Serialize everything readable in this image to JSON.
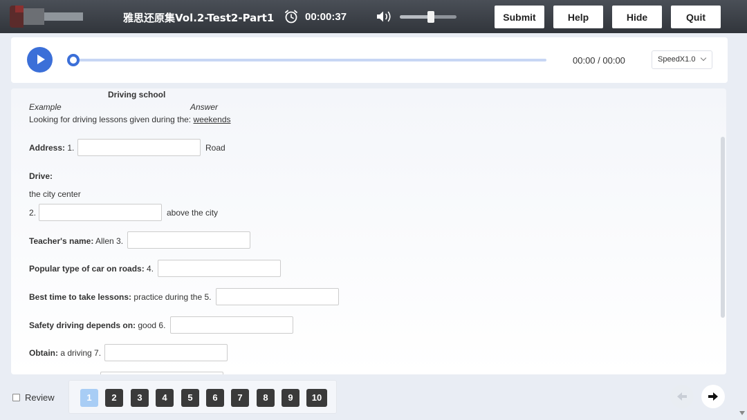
{
  "header": {
    "title": "雅思还原集Vol.2-Test2-Part1",
    "timer": "00:00:37",
    "volume_level": 0.55,
    "buttons": {
      "submit": "Submit",
      "help": "Help",
      "hide": "Hide",
      "quit": "Quit"
    }
  },
  "audio": {
    "time": "00:00 / 00:00",
    "progress": 0,
    "speed": "SpeedX1.0"
  },
  "form": {
    "heading": "Driving school",
    "example_label": "Example",
    "answer_label": "Answer",
    "example_text": "Looking for driving lessons given during the:",
    "example_answer": "weekends",
    "q1": {
      "label": "Address:",
      "number": "1.",
      "suffix": "Road",
      "value": ""
    },
    "drive_label": "Drive:",
    "drive_line": "the city center",
    "q2": {
      "number": "2.",
      "suffix": "above the city",
      "value": ""
    },
    "q3": {
      "label": "Teacher's name:",
      "prefix": "Allen 3.",
      "value": ""
    },
    "q4": {
      "label": "Popular type of car on roads:",
      "prefix": "4.",
      "value": ""
    },
    "q5": {
      "label": "Best time to take lessons:",
      "prefix": "practice during the 5.",
      "value": ""
    },
    "q6": {
      "label": "Safety driving depends on:",
      "prefix": "good 6.",
      "value": ""
    },
    "q7": {
      "label": "Obtain:",
      "prefix": "a driving 7.",
      "value": ""
    }
  },
  "footer": {
    "review_label": "Review",
    "review_checked": false,
    "questions": [
      "1",
      "2",
      "3",
      "4",
      "5",
      "6",
      "7",
      "8",
      "9",
      "10"
    ],
    "active_question": "1"
  },
  "icons": {
    "timer": "alarm-clock-icon",
    "volume": "speaker-icon",
    "play": "play-icon",
    "prev": "arrow-left-icon",
    "next": "arrow-right-icon"
  },
  "colors": {
    "topbar": "#3a3e44",
    "accent": "#3b6fd8",
    "question_button": "#3a3a3a",
    "question_active": "#a8cdf5"
  }
}
